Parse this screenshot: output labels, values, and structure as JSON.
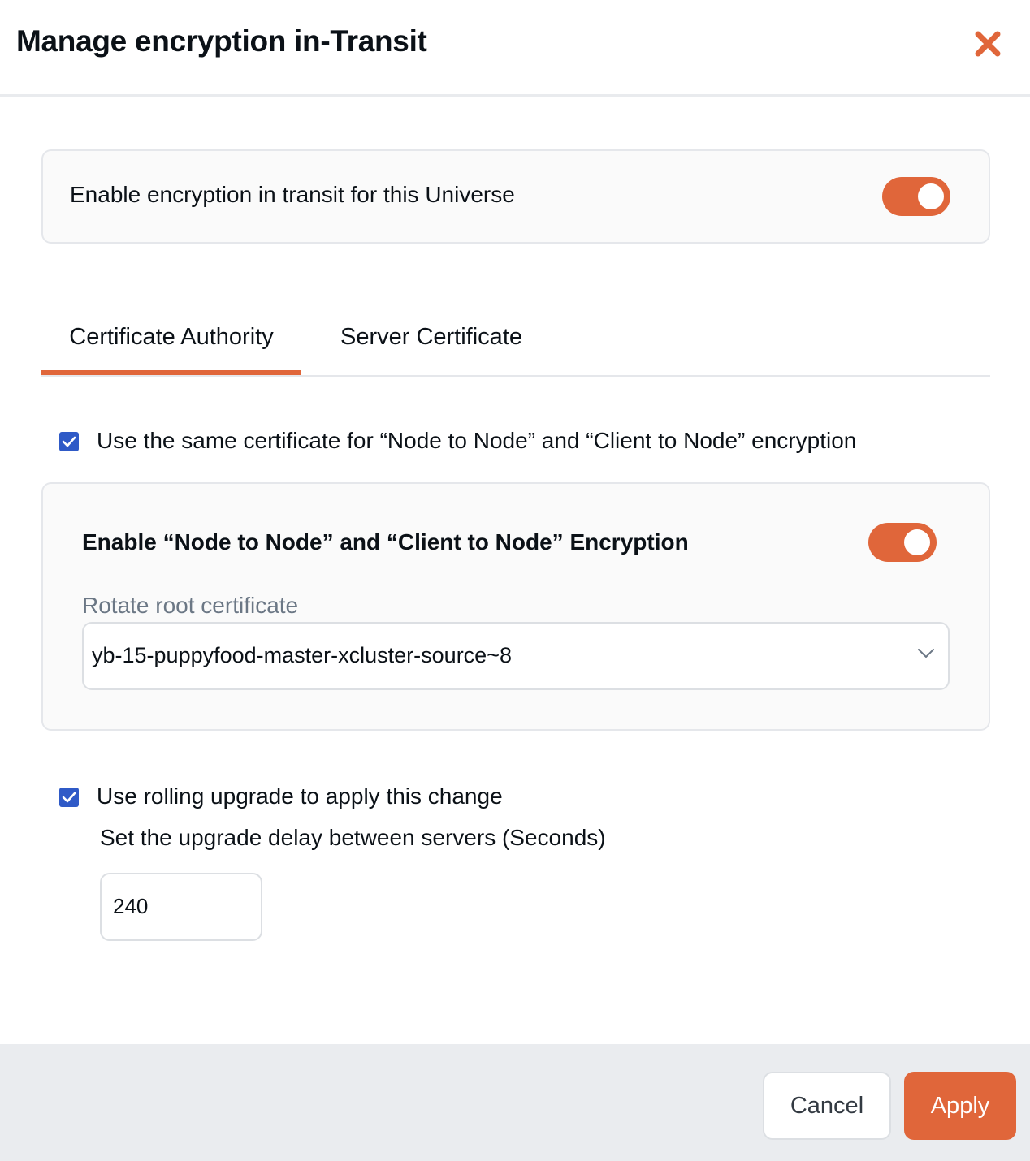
{
  "dialog": {
    "title": "Manage encryption in-Transit",
    "close_icon": "close-icon"
  },
  "main_toggle": {
    "label": "Enable encryption in transit for this Universe",
    "enabled": true
  },
  "tabs": [
    {
      "label": "Certificate Authority",
      "active": true
    },
    {
      "label": "Server Certificate",
      "active": false
    }
  ],
  "same_cert_checkbox": {
    "label": "Use the same certificate for “Node to Node” and “Client to Node” encryption",
    "checked": true
  },
  "node_encryption": {
    "label": "Enable “Node to Node” and “Client to Node” Encryption",
    "enabled": true,
    "rotate_label": "Rotate root certificate",
    "selected_certificate": "yb-15-puppyfood-master-xcluster-source~8"
  },
  "rolling_upgrade": {
    "label": "Use rolling upgrade to apply this change",
    "checked": true,
    "delay_label": "Set the upgrade delay between servers (Seconds)",
    "delay_value": "240"
  },
  "footer": {
    "cancel_label": "Cancel",
    "apply_label": "Apply"
  },
  "colors": {
    "accent": "#e0663a",
    "checkbox": "#2f5ac7",
    "footer_bg": "#eaecef"
  }
}
